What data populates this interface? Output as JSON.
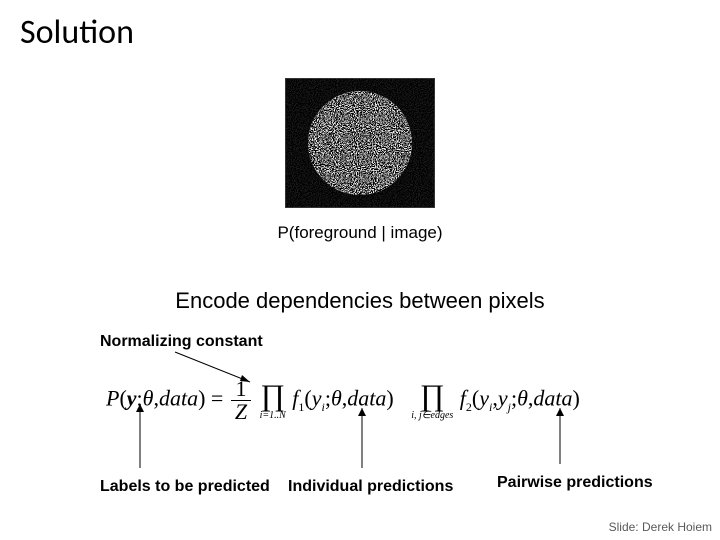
{
  "title": "Solution",
  "figure_caption": "P(foreground | image)",
  "subtitle": "Encode dependencies between pixels",
  "normalizing_label": "Normalizing constant",
  "labels_label": "Labels to be predicted",
  "individual_label": "Individual predictions",
  "pairwise_label": "Pairwise predictions",
  "credit": "Slide: Derek Hoiem",
  "eq": {
    "lhs_P": "P",
    "lhs_y": "y",
    "lhs_theta": "θ",
    "lhs_data": "data",
    "frac_num": "1",
    "frac_den": "Z",
    "prod1_under": "i=1..N",
    "f1": "f",
    "f1_sub": "1",
    "arg1_y": "y",
    "arg1_i": "i",
    "arg1_theta": "θ",
    "arg1_data": "data",
    "prod2_under": "i, j∈edges",
    "f2": "f",
    "f2_sub": "2",
    "arg2_y1": "y",
    "arg2_i": "i",
    "arg2_y2": "y",
    "arg2_j": "j",
    "arg2_theta": "θ",
    "arg2_data": "data"
  }
}
